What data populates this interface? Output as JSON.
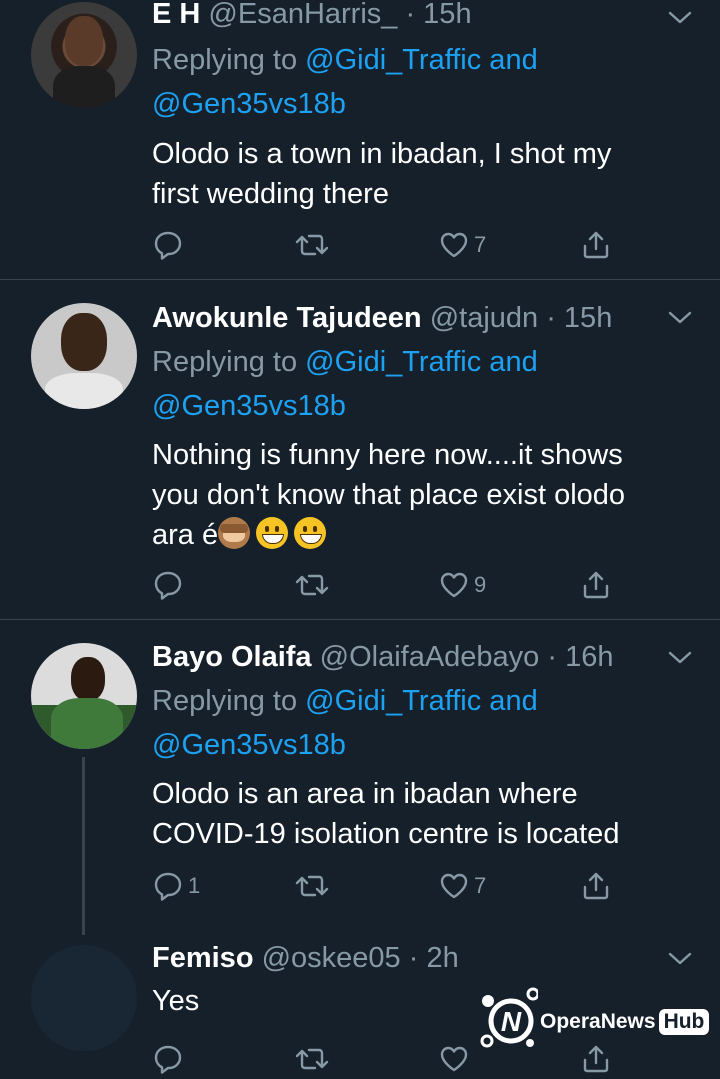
{
  "tweets": [
    {
      "name": "E H",
      "handle": "@EsanHarris_",
      "time": "· 15h",
      "replying_prefix": "Replying to",
      "replying_to": "@Gidi_Traffic and",
      "replying_to_2": "@Gen35vs18b",
      "text_lines": [
        "Olodo is a town in ibadan, I shot my",
        "first wedding there"
      ],
      "replies": "",
      "retweets": "",
      "likes": "7"
    },
    {
      "name": "Awokunle Tajudeen",
      "handle": "@tajudn",
      "time": "· 15h",
      "replying_prefix": "Replying to",
      "replying_to": "@Gidi_Traffic and",
      "replying_to_2": "@Gen35vs18b",
      "text_lines": [
        "Nothing is funny here now....it shows",
        "you don't know that place exist olodo",
        "ara é"
      ],
      "emojis": [
        "see-no-evil-monkey",
        "grinning-face",
        "grinning-face"
      ],
      "replies": "",
      "retweets": "",
      "likes": "9"
    },
    {
      "name": "Bayo Olaifa",
      "handle": "@OlaifaAdebayo",
      "time": "· 16h",
      "replying_prefix": "Replying to",
      "replying_to": "@Gidi_Traffic and",
      "replying_to_2": "@Gen35vs18b",
      "text_lines": [
        "Olodo is an area in ibadan where",
        "COVID-19 isolation centre is located"
      ],
      "replies": "1",
      "retweets": "",
      "likes": "7"
    },
    {
      "name": "Femiso",
      "handle": "@oskee05",
      "time": "· 2h",
      "text_lines": [
        "Yes"
      ]
    }
  ],
  "watermark": {
    "brand": "OperaNews",
    "badge": "Hub"
  },
  "colors": {
    "background": "#15202b",
    "separator": "#38444d",
    "text": "#ffffff",
    "muted": "#8899a6",
    "link": "#1da1f2"
  },
  "icons": [
    "reply-icon",
    "retweet-icon",
    "heart-icon",
    "share-icon",
    "chevron-down-icon"
  ]
}
